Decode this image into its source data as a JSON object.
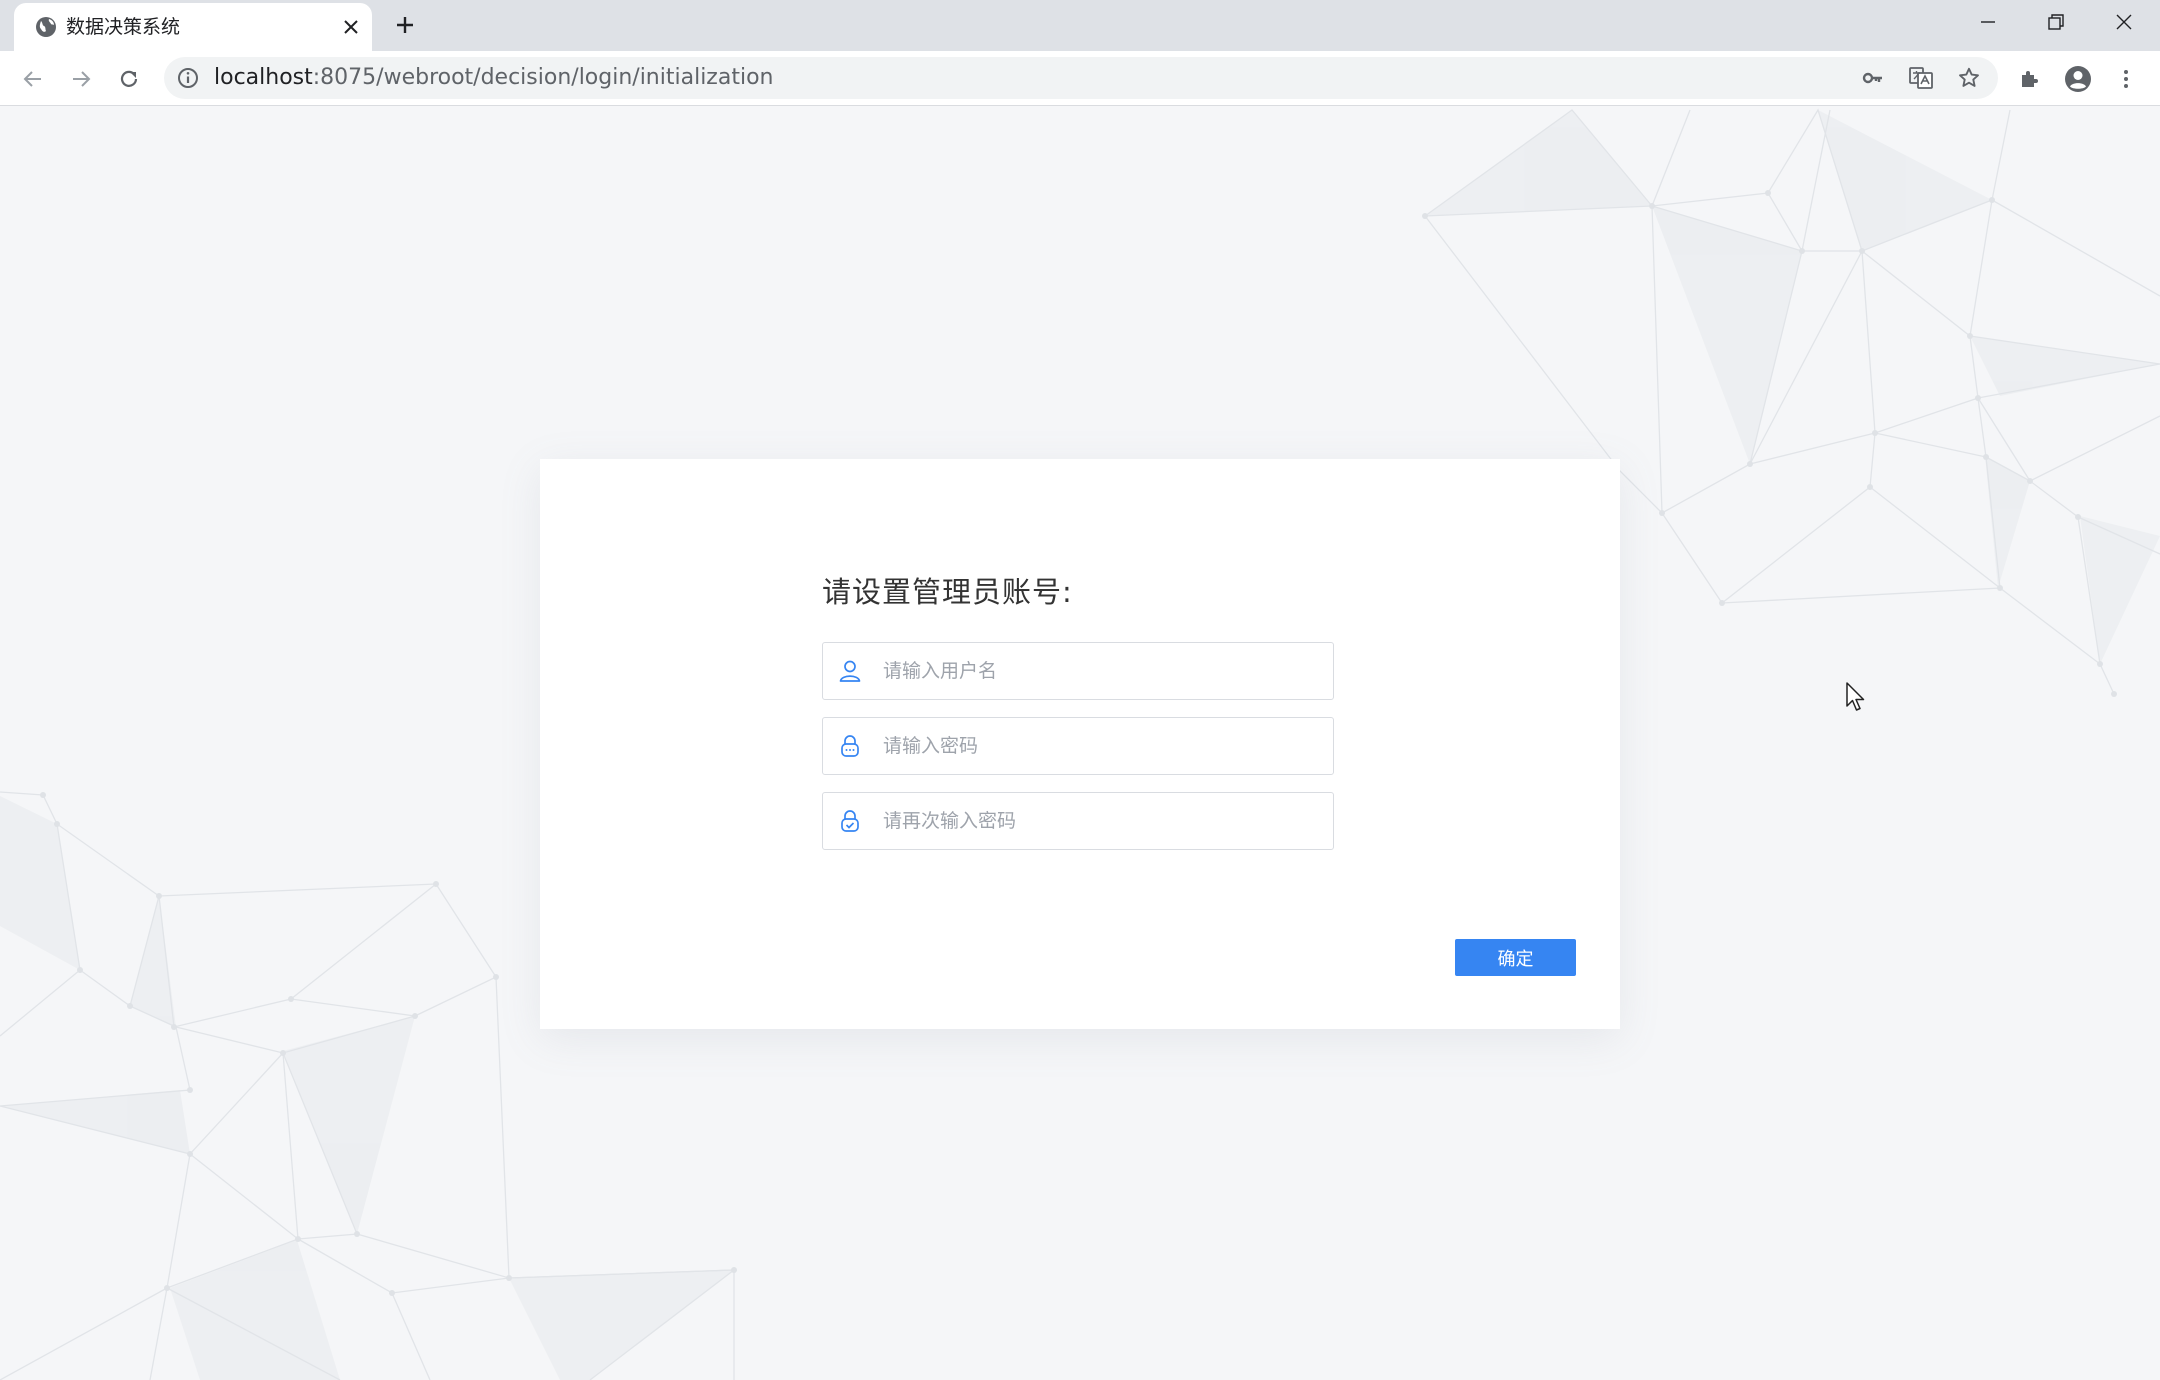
{
  "browser": {
    "tab_title": "数据决策系统",
    "url_host": "localhost",
    "url_path": ":8075/webroot/decision/login/initialization"
  },
  "form": {
    "title": "请设置管理员账号:",
    "username_placeholder": "请输入用户名",
    "password_placeholder": "请输入密码",
    "confirm_password_placeholder": "请再次输入密码",
    "submit_label": "确定"
  },
  "colors": {
    "accent": "#3685f2",
    "icon_blue": "#3685f2",
    "background": "#f5f6f8"
  }
}
